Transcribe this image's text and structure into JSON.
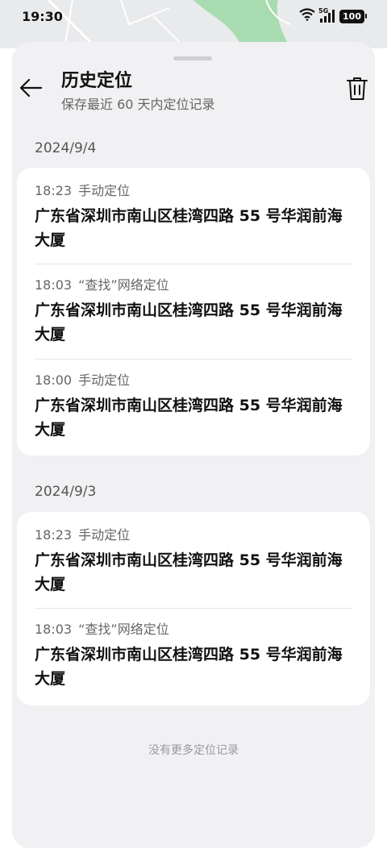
{
  "status_bar": {
    "time": "19:30",
    "network": "5G",
    "battery": "100"
  },
  "header": {
    "title": "历史定位",
    "subtitle": "保存最近 60 天内定位记录"
  },
  "groups": [
    {
      "date": "2024/9/4",
      "records": [
        {
          "time": "18:23",
          "type": "手动定位",
          "address": "广东省深圳市南山区桂湾四路 55 号华润前海大厦"
        },
        {
          "time": "18:03",
          "type": "“查找”网络定位",
          "address": "广东省深圳市南山区桂湾四路 55 号华润前海大厦"
        },
        {
          "time": "18:00",
          "type": "手动定位",
          "address": "广东省深圳市南山区桂湾四路 55 号华润前海大厦"
        }
      ]
    },
    {
      "date": "2024/9/3",
      "records": [
        {
          "time": "18:23",
          "type": "手动定位",
          "address": "广东省深圳市南山区桂湾四路 55 号华润前海大厦"
        },
        {
          "time": "18:03",
          "type": "“查找”网络定位",
          "address": "广东省深圳市南山区桂湾四路 55 号华润前海大厦"
        }
      ]
    }
  ],
  "footer": {
    "note": "没有更多定位记录"
  },
  "icons": {
    "back": "arrow-left-icon",
    "delete": "trash-icon",
    "wifi": "wifi-icon",
    "signal": "signal-icon",
    "battery": "battery-icon"
  },
  "colors": {
    "sheet_background": "#f1f1f3",
    "card_background": "#ffffff",
    "map_green": "#a8dcb0"
  }
}
